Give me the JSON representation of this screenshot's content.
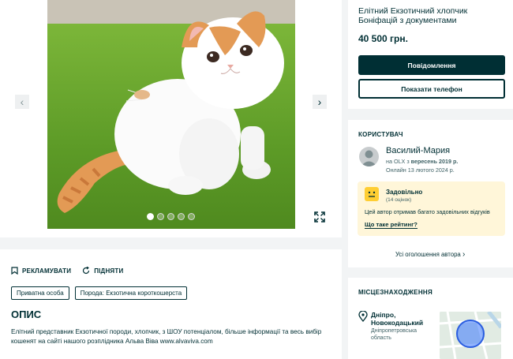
{
  "gallery": {
    "dots_total": 5,
    "dot_active": 1
  },
  "ad": {
    "title": "Елітний Екзотичний хлопчик Боніфацій з документами",
    "price": "40 500 грн.",
    "message_button": "Повідомлення",
    "phone_button": "Показати телефон"
  },
  "actions": {
    "promote": "РЕКЛАМУВАТИ",
    "raise": "ПІДНЯТИ"
  },
  "tags": [
    "Приватна особа",
    "Порода: Екзотична короткошерста"
  ],
  "description": {
    "title": "ОПИС",
    "text": "Елітний представник Екзотичної породи, хлопчик, з ШОУ потенціалом, більше інформації та весь вибір кошенят на сайті нашого розплідника Альва Віва www.alvaviva.com"
  },
  "user": {
    "section_label": "КОРИСТУВАЧ",
    "name": "Василий-Мария",
    "since_prefix": "на OLX з ",
    "since_date": "вересень 2019 р.",
    "online": "Онлайн 13 лютого 2024 р.",
    "rating_title": "Задовільно",
    "rating_count": "(14 оцінок)",
    "rating_desc": "Цей автор отримав багато задовільних відгуків",
    "rating_link": "Що таке рейтинг?",
    "all_ads": "Усі оголошення автора"
  },
  "location": {
    "section_label": "МІСЦЕЗНАХОДЖЕННЯ",
    "city": "Дніпро, Новокодацький",
    "region": "Дніпропетровська область"
  },
  "colors": {
    "primary": "#002f34",
    "rating_bg": "#fff6d9",
    "page_bg": "#f2f4f5"
  }
}
